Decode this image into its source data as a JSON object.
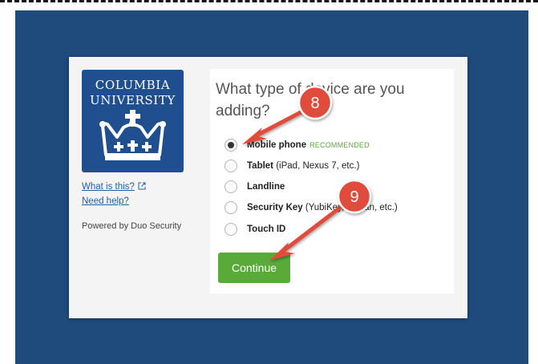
{
  "logo": {
    "line1": "COLUMBIA",
    "line2": "UNIVERSITY"
  },
  "sidebar": {
    "links": [
      "What is this?",
      "Need help?"
    ],
    "powered_by": "Powered by Duo Security"
  },
  "prompt": {
    "question": "What type of device are you adding?"
  },
  "options": [
    {
      "label": "Mobile phone",
      "detail": "",
      "badge": "RECOMMENDED",
      "selected": true
    },
    {
      "label": "Tablet",
      "detail": "(iPad, Nexus 7, etc.)",
      "selected": false
    },
    {
      "label": "Landline",
      "detail": "",
      "selected": false
    },
    {
      "label": "Security Key",
      "detail": "(YubiKey, Feitian, etc.)",
      "selected": false
    },
    {
      "label": "Touch ID",
      "detail": "",
      "selected": false
    }
  ],
  "continue_label": "Continue",
  "annotations": [
    {
      "number": "8"
    },
    {
      "number": "9"
    }
  ],
  "colors": {
    "backdrop": "#1e4a7c",
    "logo_bg": "#1f4f8e",
    "accent_green": "#5aaa3a",
    "annotation_red": "#e04b3a",
    "link": "#1f5fa8"
  },
  "icons": {
    "logo": "crown-icon",
    "external_link": "external-link-icon"
  }
}
